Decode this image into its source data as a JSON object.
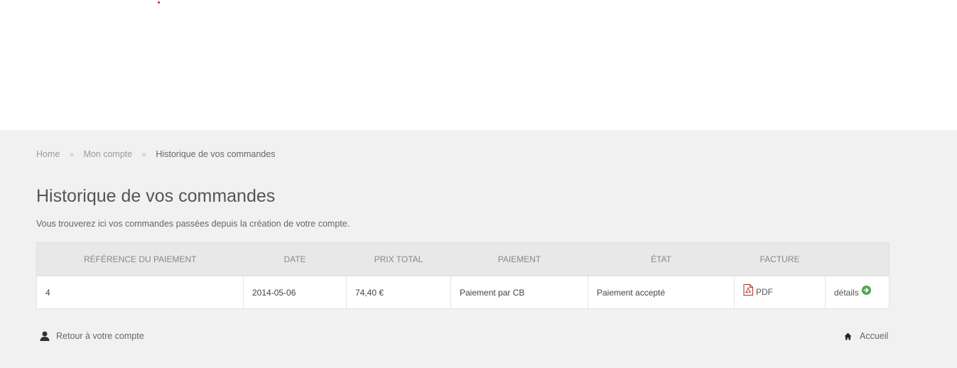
{
  "breadcrumb": {
    "items": [
      "Home",
      "Mon compte",
      "Historique de vos commandes"
    ],
    "separator": "»"
  },
  "page": {
    "title": "Historique de vos commandes",
    "intro": "Vous trouverez ici vos commandes passées depuis la création de votre compte."
  },
  "table": {
    "headers": [
      "RÉFÉRENCE DU PAIEMENT",
      "DATE",
      "PRIX TOTAL",
      "PAIEMENT",
      "ÉTAT",
      "FACTURE",
      ""
    ],
    "rows": [
      {
        "reference": "4",
        "date": "2014-05-06",
        "price": "74,40 €",
        "payment": "Paiement par CB",
        "status": "Paiement accepté",
        "invoice": "PDF",
        "details": "détails"
      }
    ]
  },
  "footer": {
    "back_label": "Retour à votre compte",
    "home_label": "Accueil"
  },
  "colors": {
    "price": "#9b1c1c",
    "background": "#f1f1f1",
    "header_bg": "#e8e8e8"
  },
  "icons": {
    "invoice": "pdf-icon",
    "details": "green-arrow-icon",
    "back": "user-icon",
    "home": "home-icon"
  }
}
